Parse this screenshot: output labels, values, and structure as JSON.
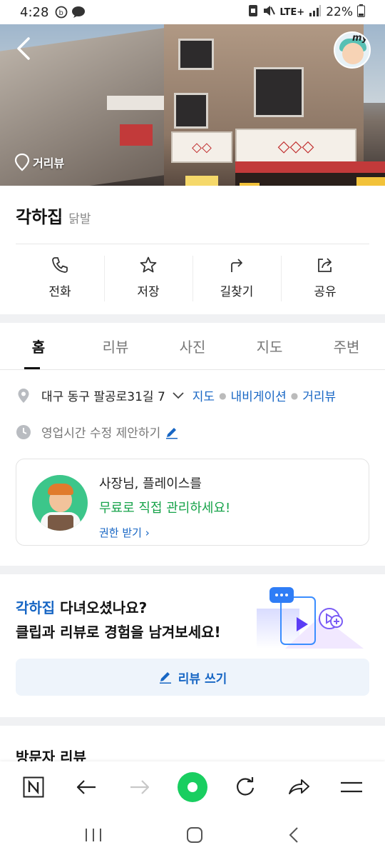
{
  "status_bar": {
    "time": "4:28",
    "network": "LTE+",
    "battery": "22%"
  },
  "hero": {
    "street_view_label": "거리뷰",
    "my_label": "my"
  },
  "place": {
    "name": "각하집",
    "category": "닭발"
  },
  "actions": [
    {
      "label": "전화",
      "icon": "phone-icon"
    },
    {
      "label": "저장",
      "icon": "star-icon"
    },
    {
      "label": "길찾기",
      "icon": "directions-icon"
    },
    {
      "label": "공유",
      "icon": "share-icon"
    }
  ],
  "tabs": [
    {
      "label": "홈",
      "active": true
    },
    {
      "label": "리뷰",
      "active": false
    },
    {
      "label": "사진",
      "active": false
    },
    {
      "label": "지도",
      "active": false
    },
    {
      "label": "주변",
      "active": false
    }
  ],
  "info": {
    "address": "대구 동구 팔공로31길 7",
    "links": [
      "지도",
      "내비게이션",
      "거리뷰"
    ],
    "hours_suggest": "영업시간 수정 제안하기"
  },
  "owner_card": {
    "line1": "사장님, 플레이스를",
    "line2": "무료로 직접 관리하세요!",
    "cta": "권한 받기"
  },
  "review_prompt": {
    "place_name": "각하집",
    "line1_rest": " 다녀오셨나요?",
    "line2": "클립과 리뷰로 경험을 남겨보세요!",
    "button": "리뷰 쓰기"
  },
  "visitor_reviews_title": "방문자 리뷰",
  "colors": {
    "accent_blue": "#1766c4",
    "naver_green": "#19ce60",
    "owner_green": "#17a34a"
  }
}
